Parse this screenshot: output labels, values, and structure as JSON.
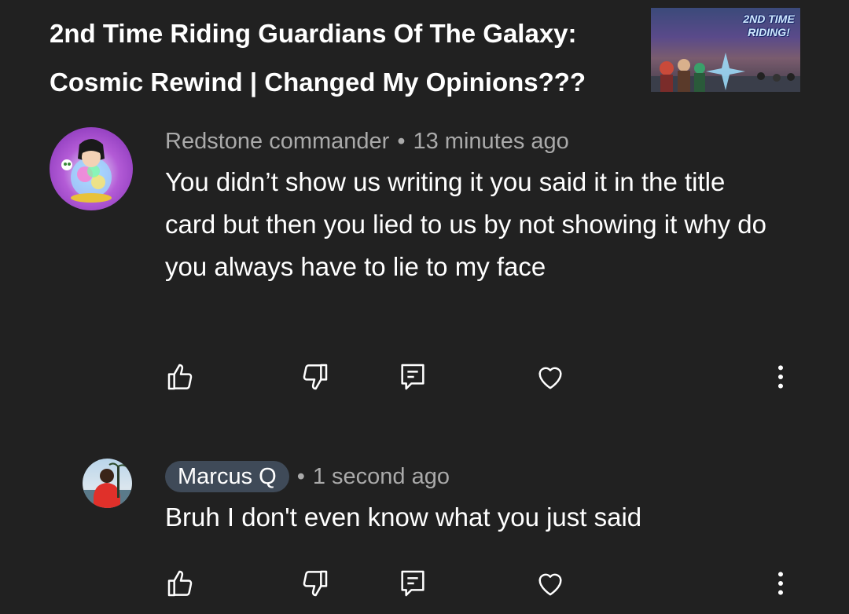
{
  "video": {
    "title": "2nd Time Riding Guardians Of The Galaxy: Cosmic Rewind | Changed My Opinions???",
    "thumbnail_text": "2ND TIME RIDING!"
  },
  "comments": [
    {
      "author": "Redstone commander",
      "separator": "•",
      "time": "13 minutes ago",
      "text": "You didn’t show us writing it you said it in the title card but then you lied to us by not showing it why do you always have to lie to my face",
      "author_highlighted": false
    },
    {
      "author": "Marcus Q",
      "separator": "•",
      "time": "1 second ago",
      "text": "Bruh I don't even know what you just said",
      "author_highlighted": true
    }
  ],
  "icons": {
    "like": "thumbs-up-icon",
    "dislike": "thumbs-down-icon",
    "reply": "reply-icon",
    "heart": "heart-icon",
    "more": "more-vertical-icon"
  },
  "colors": {
    "background": "#212121",
    "text_primary": "#ffffff",
    "text_secondary": "#aaaaaa",
    "author_chip": "#3f4a58"
  }
}
